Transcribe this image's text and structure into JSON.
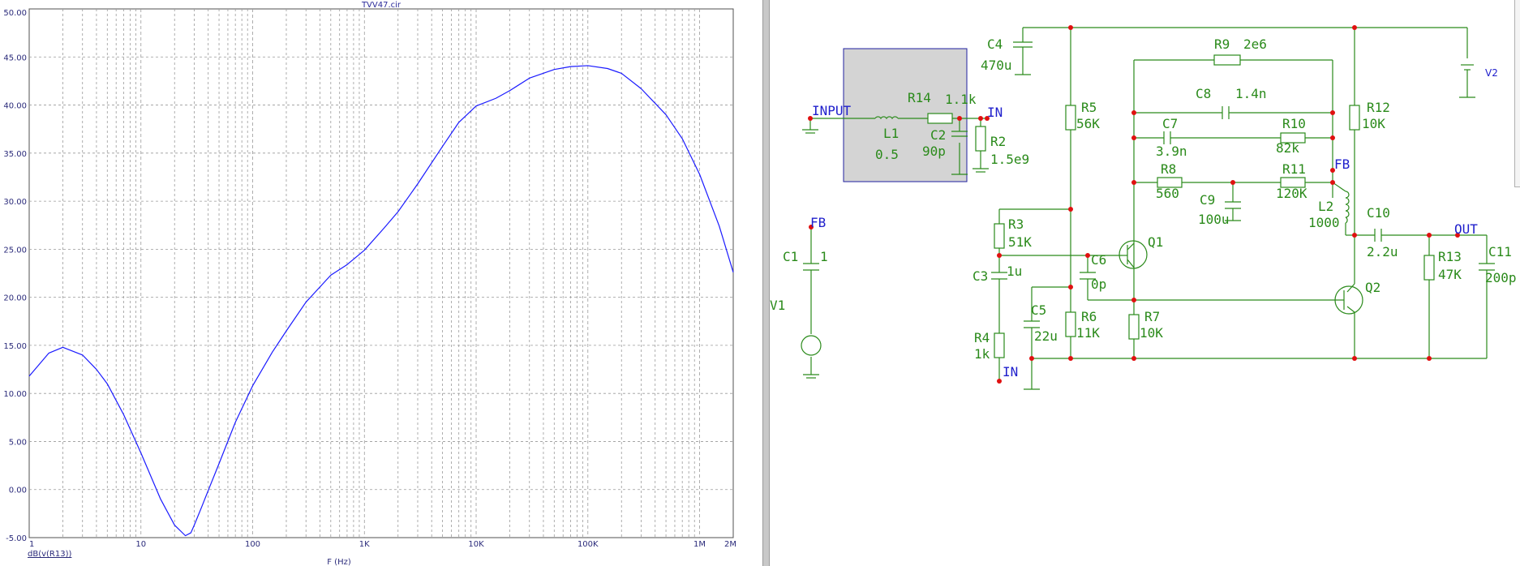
{
  "chart_data": {
    "type": "line",
    "title": "TVV47.cir",
    "xlabel": "F (Hz)",
    "ylabel": "",
    "xscale": "log",
    "xlim": [
      1,
      2000000
    ],
    "ylim": [
      -5,
      50
    ],
    "grid": true,
    "x_tick_labels": [
      "1",
      "10",
      "100",
      "1K",
      "10K",
      "100K",
      "1M",
      "2M"
    ],
    "y_tick_labels": [
      "-5.00",
      "0.00",
      "5.00",
      "10.00",
      "15.00",
      "20.00",
      "25.00",
      "30.00",
      "35.00",
      "40.00",
      "45.00",
      "50.00"
    ],
    "series": [
      {
        "name": "dB(v(R13))",
        "color": "#1a1aff",
        "x": [
          1,
          1.5,
          2,
          3,
          4,
          5,
          7,
          10,
          15,
          20,
          25,
          28,
          30,
          35,
          40,
          50,
          70,
          100,
          150,
          200,
          300,
          500,
          700,
          1000,
          1500,
          2000,
          3000,
          5000,
          7000,
          10000,
          15000,
          20000,
          30000,
          50000,
          70000,
          100000,
          150000,
          200000,
          300000,
          500000,
          700000,
          1000000,
          1500000,
          2000000
        ],
        "y": [
          11.8,
          14.2,
          14.8,
          14.0,
          12.5,
          11.0,
          7.8,
          3.8,
          -1.0,
          -3.7,
          -4.8,
          -4.5,
          -3.7,
          -1.8,
          -0.1,
          2.7,
          7.0,
          10.8,
          14.3,
          16.5,
          19.5,
          22.3,
          23.4,
          24.9,
          27.2,
          28.9,
          31.8,
          35.7,
          38.2,
          39.9,
          40.7,
          41.5,
          42.8,
          43.7,
          44.0,
          44.1,
          43.8,
          43.3,
          41.7,
          39.0,
          36.5,
          32.8,
          27.4,
          22.6
        ]
      }
    ]
  },
  "schematic": {
    "components": {
      "c4": {
        "ref": "C4",
        "value": "470u"
      },
      "r9": {
        "ref": "R9",
        "value": "2e6"
      },
      "r14": {
        "ref": "R14",
        "value": "1.1k"
      },
      "l1": {
        "ref": "L1",
        "value": "0.5"
      },
      "c2": {
        "ref": "C2",
        "value": "90p"
      },
      "r2": {
        "ref": "R2",
        "value": "1.5e9"
      },
      "r5": {
        "ref": "R5",
        "value": "56K"
      },
      "c8": {
        "ref": "C8",
        "value": "1.4n"
      },
      "c7": {
        "ref": "C7",
        "value": "3.9n"
      },
      "r10": {
        "ref": "R10",
        "value": "82k"
      },
      "r12": {
        "ref": "R12",
        "value": "10K"
      },
      "r8": {
        "ref": "R8",
        "value": "560"
      },
      "c9": {
        "ref": "C9",
        "value": "100u"
      },
      "r11": {
        "ref": "R11",
        "value": "120K"
      },
      "l2": {
        "ref": "L2",
        "value": "1000"
      },
      "c10": {
        "ref": "C10",
        "value": "2.2u"
      },
      "r3": {
        "ref": "R3",
        "value": "51K"
      },
      "c6": {
        "ref": "C6",
        "value": "0p"
      },
      "c3": {
        "ref": "C3",
        "value": "1u"
      },
      "c1": {
        "ref": "C1",
        "value": "1"
      },
      "r13": {
        "ref": "R13",
        "value": "47K"
      },
      "c11": {
        "ref": "C11",
        "value": "200p"
      },
      "c5": {
        "ref": "C5",
        "value": "22u"
      },
      "r6": {
        "ref": "R6",
        "value": "11K"
      },
      "r7": {
        "ref": "R7",
        "value": "10K"
      },
      "r4": {
        "ref": "R4",
        "value": "1k"
      },
      "q1": {
        "ref": "Q1"
      },
      "q2": {
        "ref": "Q2"
      },
      "v1": {
        "ref": "V1"
      },
      "v2": {
        "ref": "V2"
      }
    },
    "nodes": {
      "input": "INPUT",
      "in_top": "IN",
      "in_bottom": "IN",
      "fb_left": "FB",
      "fb_right": "FB",
      "out": "OUT"
    },
    "colors": {
      "wire": "#2a8a1a",
      "junction": "#e01010",
      "node_label": "#2020cc",
      "subcircuit_fill": "#d4d4d4",
      "subcircuit_border": "#2020a0"
    }
  }
}
